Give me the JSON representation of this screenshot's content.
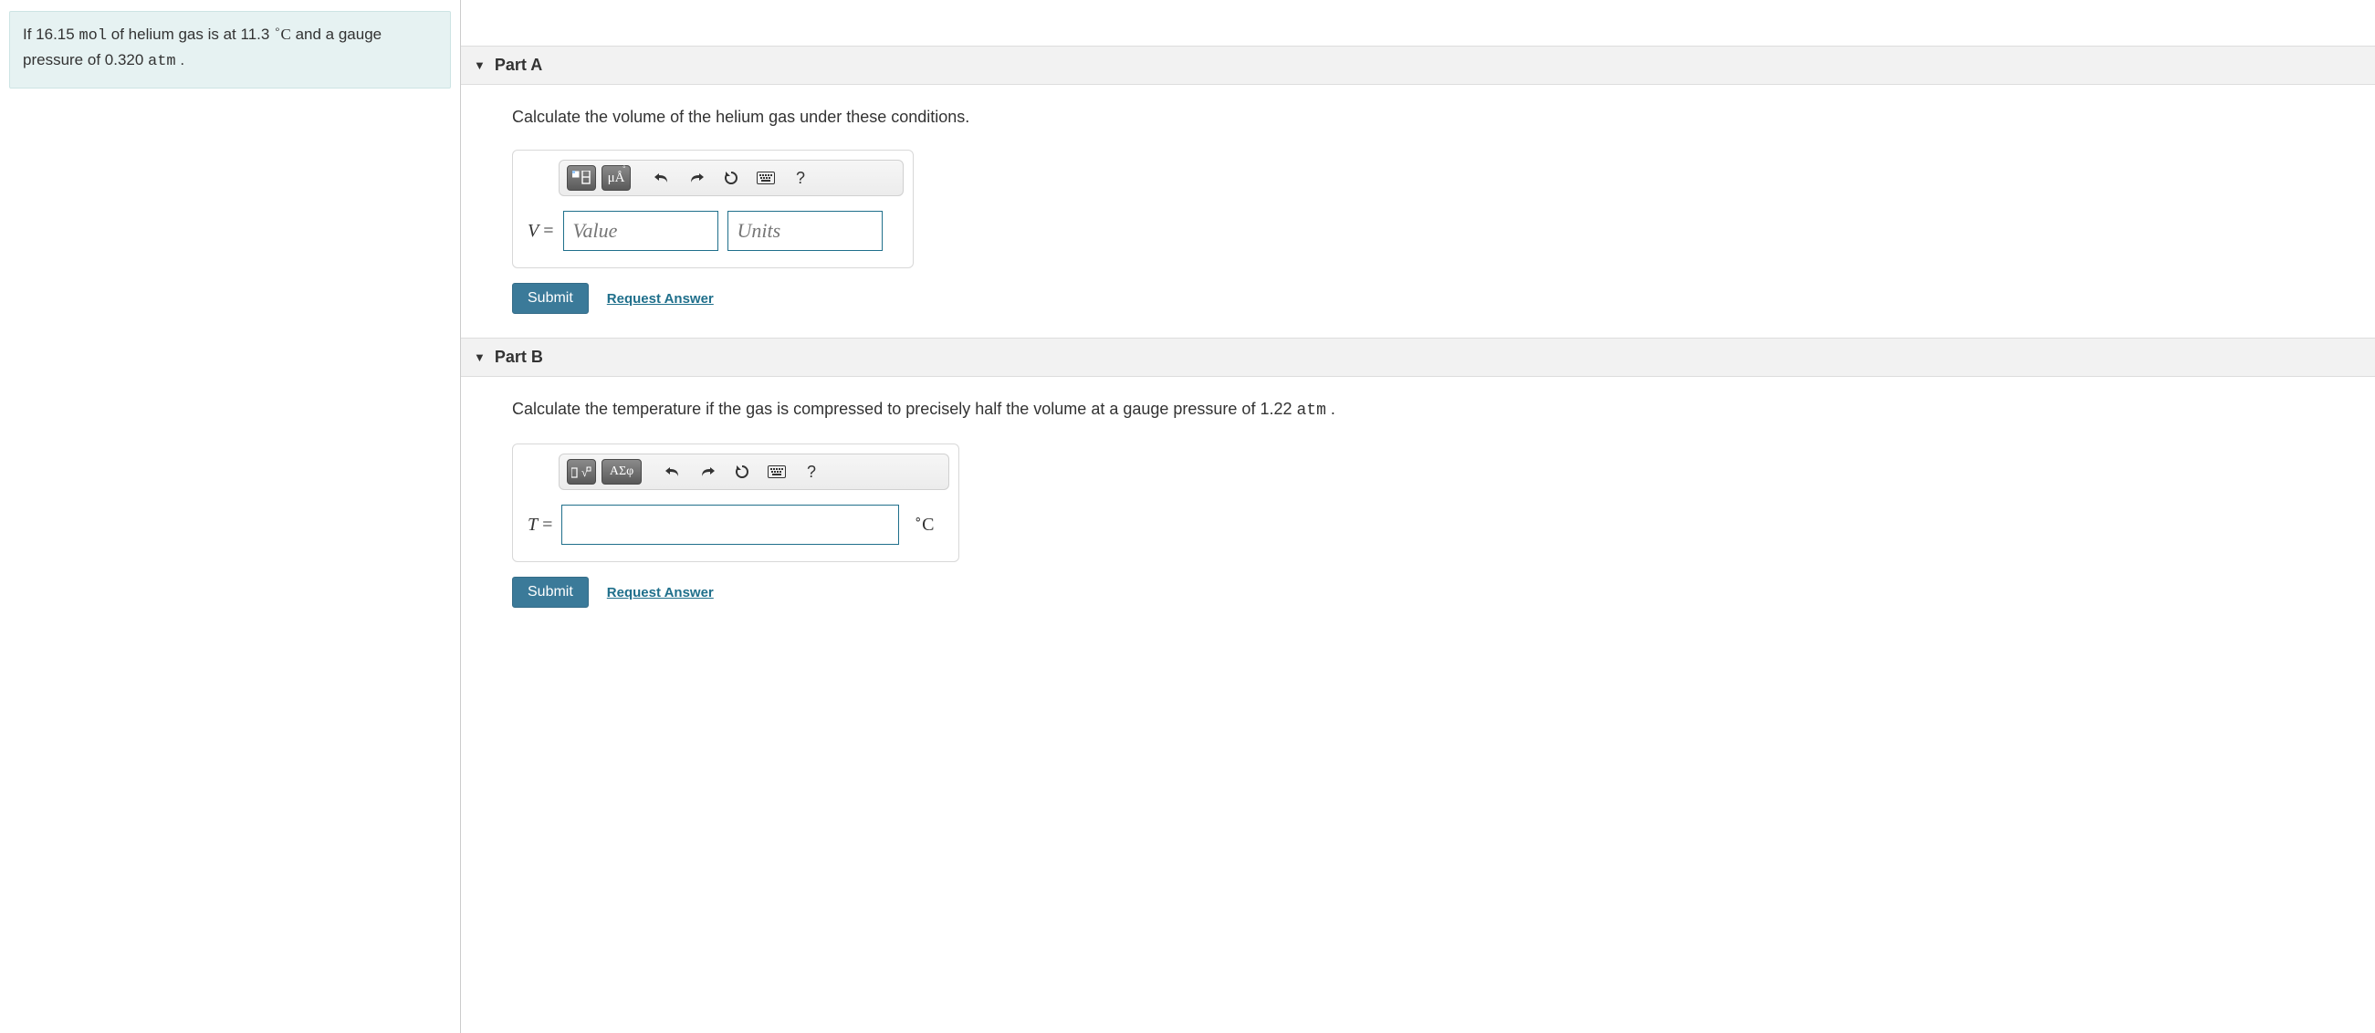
{
  "intro": {
    "pre1": "If 16.15 ",
    "mol": "mol",
    "mid1": " of helium gas is at 11.3 ",
    "deg": "∘",
    "C": "C",
    "mid2": " and a gauge pressure of 0.320 ",
    "atm": "atm",
    "end": " ."
  },
  "partA": {
    "header": "Part A",
    "prompt": "Calculate the volume of the helium gas under these conditions.",
    "variable": "V",
    "eq_sign": " = ",
    "value_placeholder": "Value",
    "units_placeholder": "Units",
    "submit": "Submit",
    "request": "Request Answer",
    "toolbar": {
      "templates": "templates",
      "symbols": "μÅ",
      "undo": "undo",
      "redo": "redo",
      "reset": "reset",
      "keyboard": "keyboard",
      "help": "?"
    }
  },
  "partB": {
    "header": "Part B",
    "prompt_pre": "Calculate the temperature if the gas is compressed to precisely half the volume at a gauge pressure of 1.22 ",
    "prompt_unit": "atm",
    "prompt_end": " .",
    "variable": "T",
    "eq_sign": " = ",
    "unit_suffix_deg": "∘",
    "unit_suffix_C": "C",
    "submit": "Submit",
    "request": "Request Answer",
    "toolbar": {
      "templates": "templates",
      "symbols": "ΑΣφ",
      "undo": "undo",
      "redo": "redo",
      "reset": "reset",
      "keyboard": "keyboard",
      "help": "?"
    }
  }
}
